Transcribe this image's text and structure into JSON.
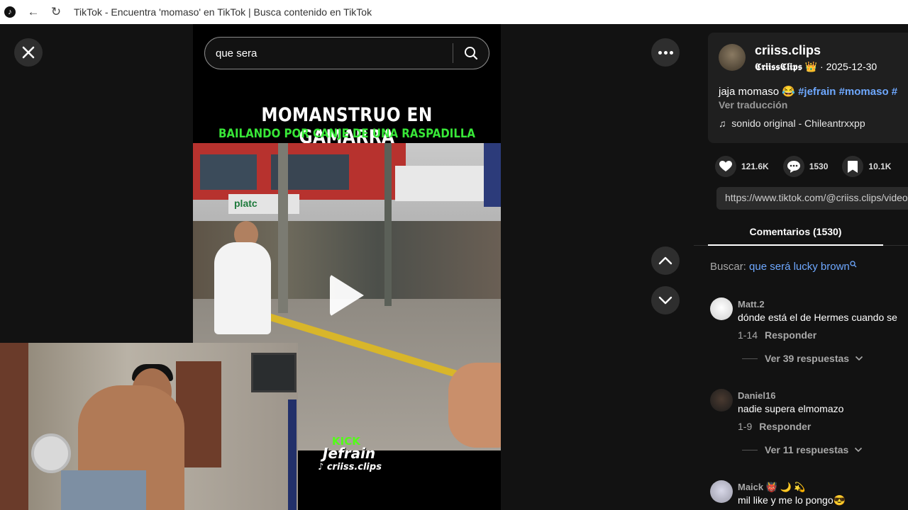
{
  "browser": {
    "title": "TikTok - Encuentra 'momaso' en TikTok | Busca contenido en TikTok"
  },
  "video": {
    "search_value": "que sera",
    "caption_line1": "MOMANSTRUO EN GAMARRA",
    "caption_line2": "BAILANDO POR CANJE DE UNA RASPADILLA",
    "sign_text": "platc",
    "watermark_kick": "KICK",
    "watermark_name": "Jefrain",
    "watermark_handle": "criiss.clips"
  },
  "post": {
    "username": "criiss.clips",
    "nickname": "𝕮𝖗𝖎𝖎𝖘𝖘𝕮𝖑𝖎𝖕𝖘",
    "nickname_emoji": "👑",
    "date": "· 2025-12-30",
    "description": "jaja momaso 😂",
    "hashtags": [
      "#jefrain",
      "#momaso",
      "#"
    ],
    "translate": "Ver traducción",
    "music": "sonido original - Chileantrxxpp",
    "likes": "121.6K",
    "comments": "1530",
    "saves": "10.1K",
    "link": "https://www.tiktok.com/@criiss.clips/video/"
  },
  "comments_tab": {
    "label": "Comentarios (1530)"
  },
  "search_suggestion": {
    "prefix": "Buscar:",
    "query": "que será lucky brown"
  },
  "comments": [
    {
      "user": "Matt.2",
      "text": "dónde está el de Hermes cuando se",
      "date": "1-14",
      "reply": "Responder",
      "replies": "Ver 39 respuestas"
    },
    {
      "user": "Daniel16",
      "text": "nadie supera elmomazo",
      "date": "1-9",
      "reply": "Responder",
      "replies": "Ver 11 respuestas"
    },
    {
      "user": "Maick 👹 🌙 💫",
      "text": "mil like y me lo pongo😎"
    }
  ],
  "colors": {
    "background": "#121212",
    "accent_link": "#6ea8ff",
    "kick_green": "#53fc18",
    "caption_green": "#38e838"
  }
}
